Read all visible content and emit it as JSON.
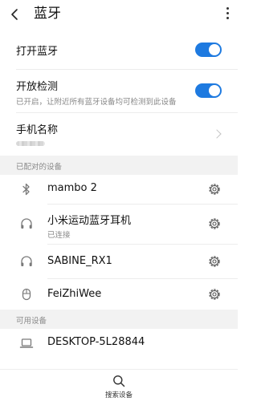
{
  "header": {
    "title": "蓝牙"
  },
  "settings": {
    "bluetooth": {
      "label": "打开蓝牙",
      "enabled": true
    },
    "discoverable": {
      "label": "开放检测",
      "description": "已开启，让附近所有蓝牙设备均可检测到此设备",
      "enabled": true
    },
    "device_name": {
      "label": "手机名称"
    }
  },
  "paired_section": {
    "title": "已配对的设备",
    "devices": [
      {
        "name": "mambo 2",
        "status": "",
        "icon": "bluetooth-icon"
      },
      {
        "name": "小米运动蓝牙耳机",
        "status": "已连接",
        "icon": "headphones-icon"
      },
      {
        "name": "SABINE_RX1",
        "status": "",
        "icon": "headphones-icon"
      },
      {
        "name": "FeiZhiWee",
        "status": "",
        "icon": "mouse-icon"
      }
    ]
  },
  "available_section": {
    "title": "可用设备",
    "devices": [
      {
        "name": "DESKTOP-5L28844",
        "icon": "laptop-icon"
      }
    ]
  },
  "bottom": {
    "search_label": "搜索设备"
  },
  "colors": {
    "accent": "#1e7ae0",
    "section_bg": "#f2f2f2",
    "secondary_text": "#888888"
  }
}
